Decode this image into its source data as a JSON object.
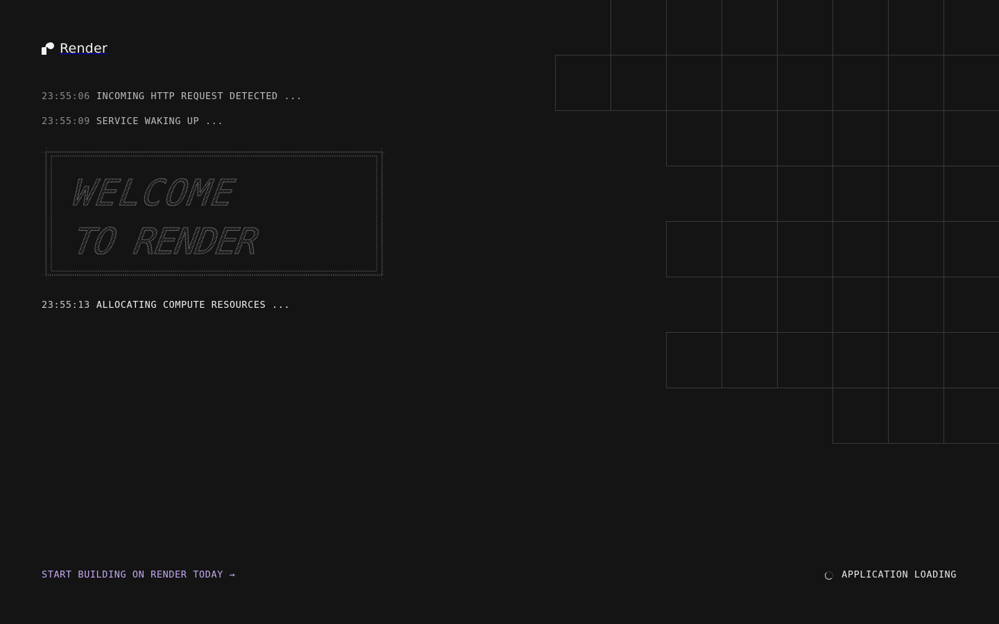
{
  "brand": {
    "name": "Render"
  },
  "log": [
    {
      "time": "23:55:06",
      "message": "INCOMING HTTP REQUEST DETECTED ..."
    },
    {
      "time": "23:55:09",
      "message": "SERVICE WAKING UP ..."
    },
    {
      "time": "23:55:13",
      "message": "ALLOCATING COMPUTE RESOURCES ..."
    }
  ],
  "banner": {
    "line1": "WELCOME",
    "line2": "TO RENDER"
  },
  "footer": {
    "cta_label": "START BUILDING ON RENDER TODAY →",
    "status_label": "APPLICATION LOADING"
  },
  "colors": {
    "background": "#141414",
    "accent": "#c4a8ef",
    "grid_line": "#3a3a3a"
  }
}
